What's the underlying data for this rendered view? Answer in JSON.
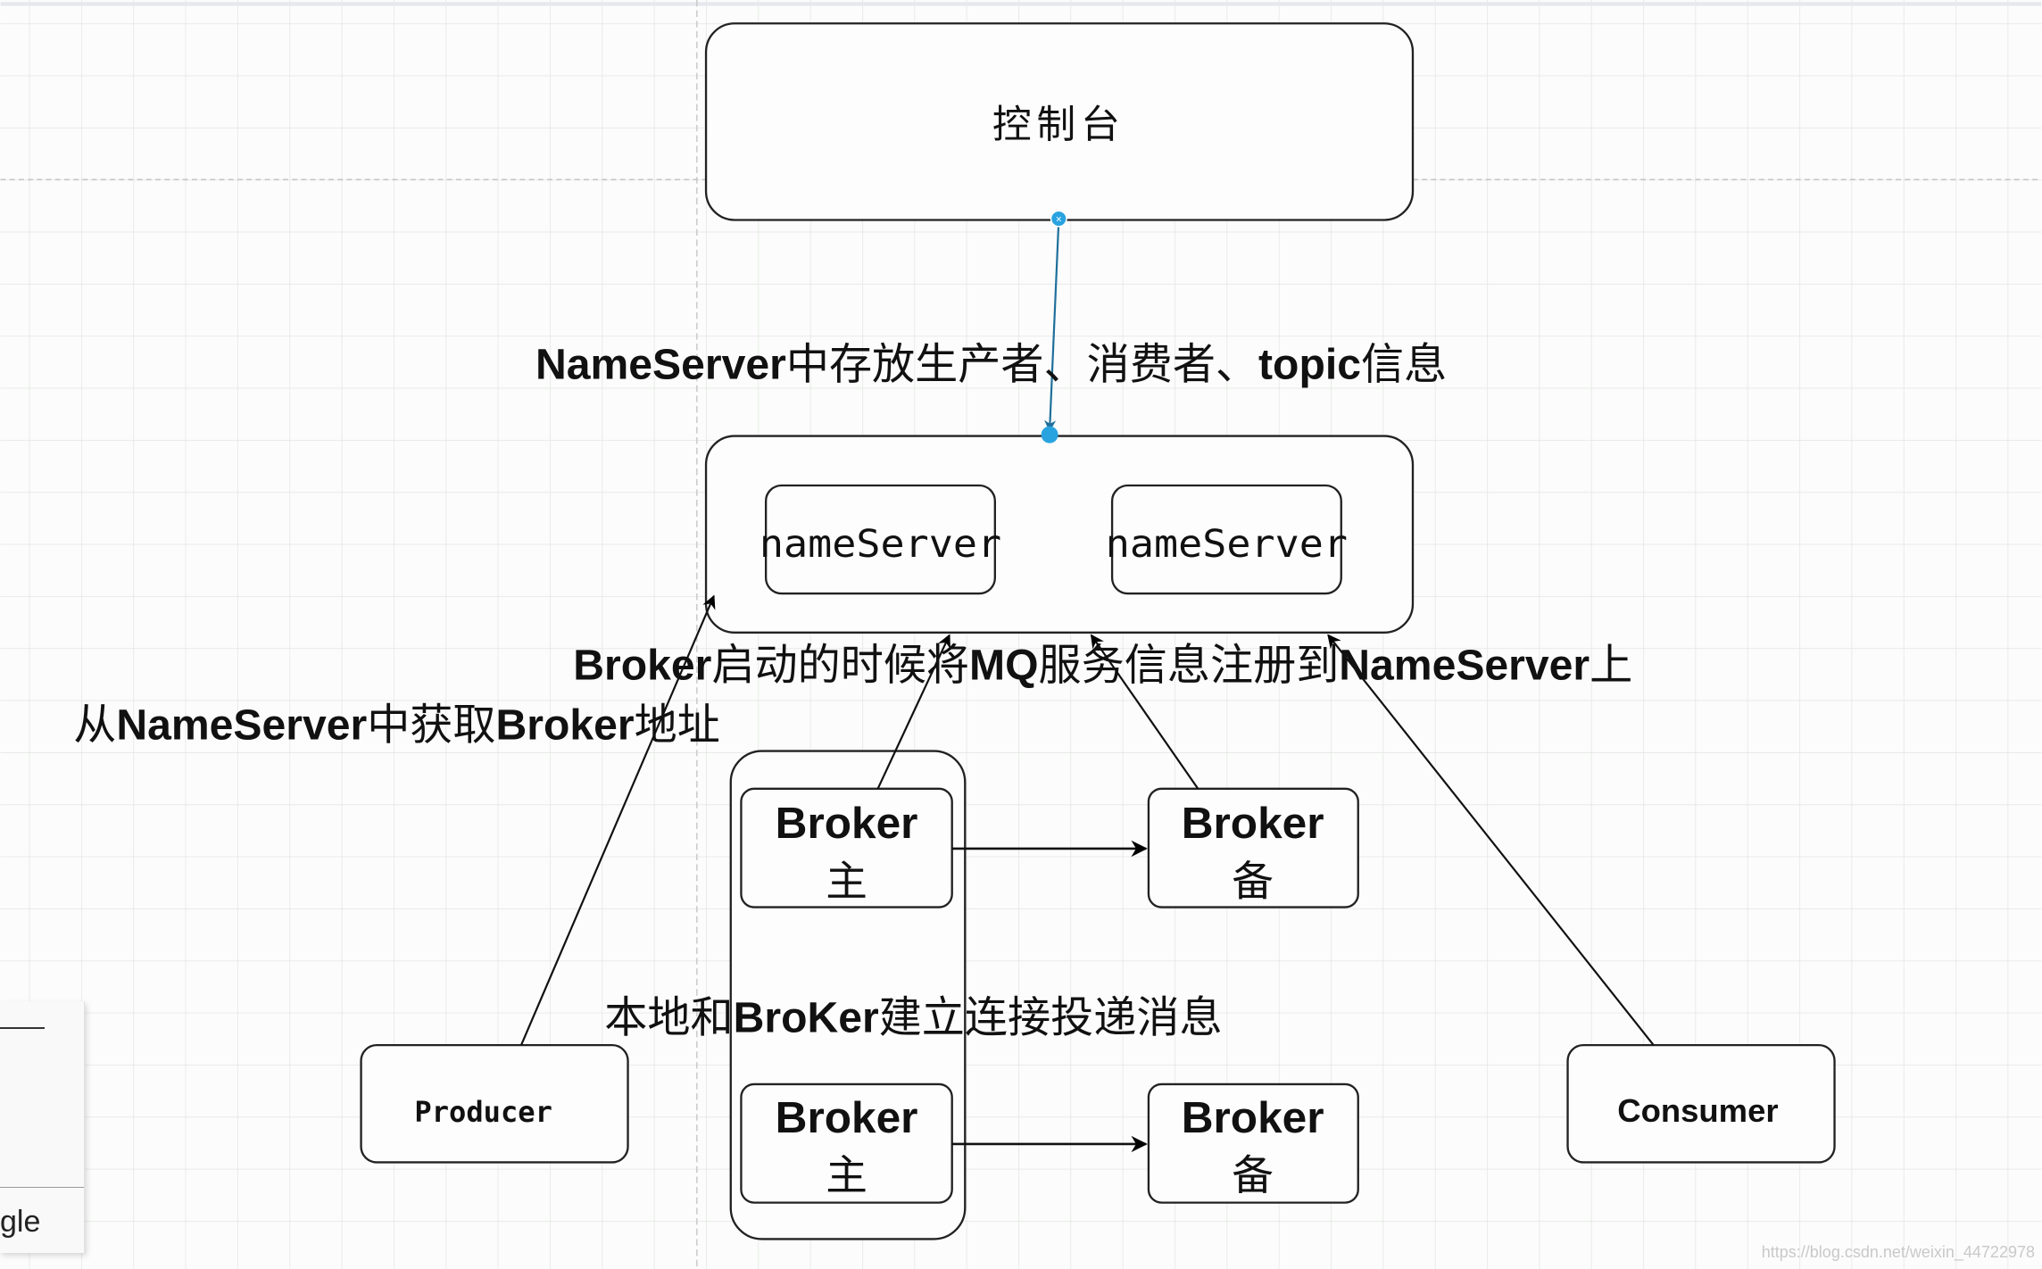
{
  "diagram": {
    "console": {
      "label": "控制台"
    },
    "nameserver_cluster": {
      "nodes": [
        {
          "label": "nameServer"
        },
        {
          "label": "nameServer"
        }
      ]
    },
    "brokers": [
      {
        "name": "Broker",
        "role": "主"
      },
      {
        "name": "Broker",
        "role": "备"
      },
      {
        "name": "Broker",
        "role": "主"
      },
      {
        "name": "Broker",
        "role": "备"
      }
    ],
    "producer": {
      "label": "Producer"
    },
    "consumer": {
      "label": "Consumer"
    },
    "annotations": {
      "nameserver_store": [
        {
          "text": "NameServer",
          "style": "en"
        },
        {
          "text": "中存放生产者、消费者、",
          "style": "cn"
        },
        {
          "text": "topic",
          "style": "en"
        },
        {
          "text": "信息",
          "style": "cn"
        }
      ],
      "broker_register": [
        {
          "text": "Broker",
          "style": "en"
        },
        {
          "text": "启动的时候将",
          "style": "cn"
        },
        {
          "text": "MQ",
          "style": "en"
        },
        {
          "text": "服务信息注册到",
          "style": "cn"
        },
        {
          "text": "NameServer",
          "style": "en"
        },
        {
          "text": "上",
          "style": "cn"
        }
      ],
      "get_broker_address": [
        {
          "text": "从",
          "style": "cn"
        },
        {
          "text": "NameServer",
          "style": "en"
        },
        {
          "text": "中获取",
          "style": "cn"
        },
        {
          "text": "Broker",
          "style": "en"
        },
        {
          "text": "地址",
          "style": "cn"
        }
      ],
      "connect_deliver": [
        {
          "text": "本地和",
          "style": "cn"
        },
        {
          "text": "BroKer",
          "style": "en"
        },
        {
          "text": "建立连接投递消息",
          "style": "cn"
        }
      ]
    },
    "edges": [
      {
        "from": "console",
        "to": "nameserver_cluster",
        "selected": true
      },
      {
        "from": "broker_master_1",
        "to": "nameserver_cluster"
      },
      {
        "from": "broker_slave_1",
        "to": "nameserver_cluster"
      },
      {
        "from": "consumer",
        "to": "nameserver_cluster"
      },
      {
        "from": "producer",
        "to": "nameserver_cluster"
      },
      {
        "from": "broker_master_1",
        "to": "broker_slave_1"
      },
      {
        "from": "broker_master_2",
        "to": "broker_slave_2"
      }
    ],
    "selection_color": "#29a3e0"
  },
  "side_panel": {
    "label": "gle"
  },
  "watermark": "https://blog.csdn.net/weixin_44722978"
}
